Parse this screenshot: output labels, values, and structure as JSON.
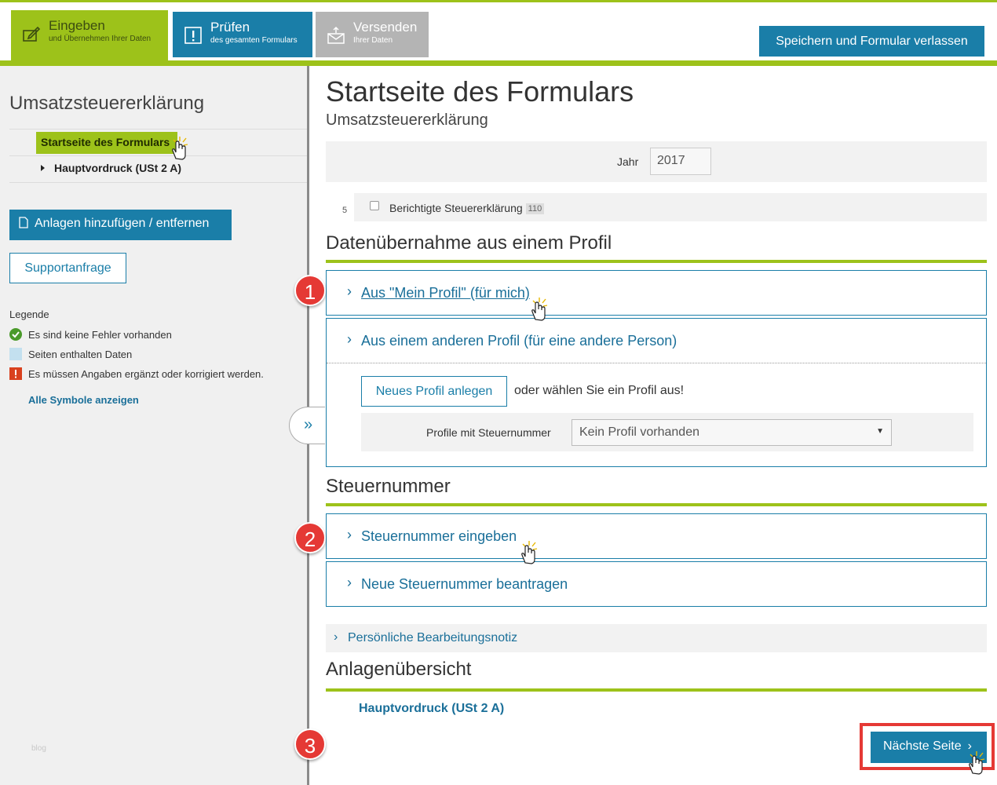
{
  "tabs": [
    {
      "title": "Eingeben",
      "subtitle": "und Übernehmen Ihrer Daten"
    },
    {
      "title": "Prüfen",
      "subtitle": "des gesamten Formulars"
    },
    {
      "title": "Versenden",
      "subtitle": "Ihrer Daten"
    }
  ],
  "header": {
    "save_exit_label": "Speichern und Formular verlassen"
  },
  "sidebar": {
    "title": "Umsatzsteuererklärung",
    "nav": [
      {
        "label": "Startseite des Formulars"
      },
      {
        "label": "Hauptvordruck (USt 2 A)"
      }
    ],
    "add_attachments_label": "Anlagen hinzufügen / entfernen",
    "support_label": "Supportanfrage",
    "legend": {
      "title": "Legende",
      "items": [
        {
          "text": "Es sind keine Fehler vorhanden",
          "color": "#4a9a2a"
        },
        {
          "text": "Seiten enthalten Daten",
          "color": "#c3e0ef"
        },
        {
          "text": "Es müssen Angaben ergänzt oder korrigiert werden.",
          "color": "#d9411e"
        }
      ],
      "show_all_label": "Alle Symbole anzeigen"
    },
    "watermark": "blog",
    "collapse_icon": "»"
  },
  "main": {
    "title": "Startseite des Formulars",
    "subtitle": "Umsatzsteuererklärung",
    "year": {
      "label": "Jahr",
      "value": "2017"
    },
    "correction": {
      "row_number": "5",
      "label": "Berichtigte Steuererklärung",
      "code": "110",
      "checked": false
    },
    "profile_section": {
      "heading": "Datenübernahme aus einem Profil",
      "own_profile_label": "Aus \"Mein Profil\" (für mich)",
      "other_profile_label": "Aus einem anderen Profil (für eine andere Person)",
      "new_profile_label": "Neues Profil anlegen",
      "or_choose_text": "oder wählen Sie ein Profil aus!",
      "select_label": "Profile mit Steuernummer",
      "select_value": "Kein Profil vorhanden"
    },
    "tax_section": {
      "heading": "Steuernummer",
      "enter_label": "Steuernummer eingeben",
      "apply_label": "Neue Steuernummer beantragen"
    },
    "note_label": "Persönliche Bearbeitungsnotiz",
    "attachments_section": {
      "heading": "Anlagenübersicht",
      "items": [
        "Hauptvordruck (USt 2 A)"
      ]
    },
    "next_label": "Nächste Seite"
  },
  "annotations": [
    "1",
    "2",
    "3"
  ],
  "colors": {
    "accent_green": "#9dc21a",
    "primary_blue": "#1a7ea8",
    "link_blue": "#1a6f99",
    "highlight_red": "#e53935"
  }
}
